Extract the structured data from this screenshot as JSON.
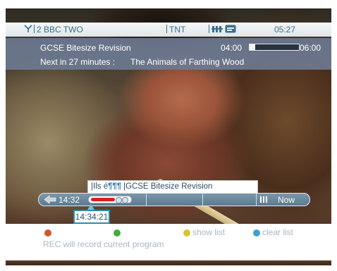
{
  "status_bar": {
    "channel": "2 BBC TWO",
    "network": "TNT",
    "clock": "05:27",
    "icons": [
      "antenna-icon",
      "signal-icon",
      "subtitle-icon"
    ]
  },
  "now_playing": {
    "title": "GCSE Bitesize Revision",
    "start": "04:00",
    "end": "06:00",
    "progress": 0.12,
    "next_label": "Next in 27 minutes :",
    "next_title": "The Animals of Farthing Wood"
  },
  "timeline": {
    "tooltip_prev": "Ils é",
    "tooltip_title": "GCSE Bitesize Revision",
    "start_time": "14:32",
    "current_time": "14:34:21",
    "now_label": "Now",
    "colors": {
      "recorded": "#d81f1f",
      "bar": "#6d889c",
      "pointer": "#5fc9df"
    }
  },
  "help": {
    "show_list": "show list",
    "clear_list": "clear list",
    "message": "REC will record current program",
    "colors": {
      "red": "#d4552e",
      "green": "#3fae3a",
      "yellow": "#d8c52a",
      "blue": "#3aa2cc"
    }
  }
}
